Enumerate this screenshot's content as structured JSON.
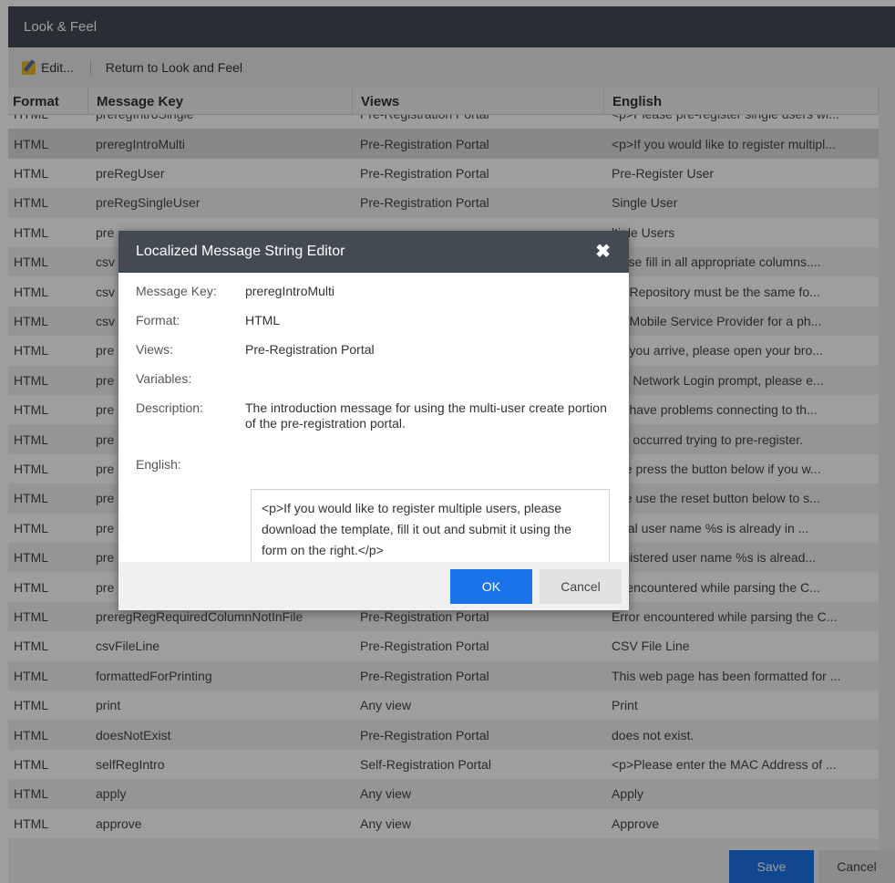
{
  "window": {
    "title": "Look & Feel"
  },
  "toolbar": {
    "edit_label": "Edit...",
    "return_label": "Return to Look and Feel"
  },
  "grid": {
    "headers": [
      "Format",
      "Message Key",
      "Views",
      "English"
    ],
    "rows": [
      {
        "format": "HTML",
        "key": "preregIntroSingle",
        "views": "Pre-Registration Portal",
        "english": "<p>Please pre-register single users wi..."
      },
      {
        "format": "HTML",
        "key": "preregIntroMulti",
        "views": "Pre-Registration Portal",
        "english": "<p>If you would like to register multipl..."
      },
      {
        "format": "HTML",
        "key": "preRegUser",
        "views": "Pre-Registration Portal",
        "english": "Pre-Register User"
      },
      {
        "format": "HTML",
        "key": "preRegSingleUser",
        "views": "Pre-Registration Portal",
        "english": "Single User"
      },
      {
        "format": "HTML",
        "key": "pre",
        "views": "",
        "english": "ltiple Users"
      },
      {
        "format": "HTML",
        "key": "csv",
        "views": "",
        "english": "lease fill in all appropriate columns...."
      },
      {
        "format": "HTML",
        "key": "csv",
        "views": "",
        "english": "he Repository must be the same fo..."
      },
      {
        "format": "HTML",
        "key": "csv",
        "views": "",
        "english": "he Mobile Service Provider for a ph..."
      },
      {
        "format": "HTML",
        "key": "pre",
        "views": "",
        "english": "en you arrive, please open your bro..."
      },
      {
        "format": "HTML",
        "key": "pre",
        "views": "",
        "english": "the Network Login prompt, please e..."
      },
      {
        "format": "HTML",
        "key": "pre",
        "views": "",
        "english": "ou have problems connecting to th..."
      },
      {
        "format": "HTML",
        "key": "pre",
        "views": "",
        "english": "ors occurred trying to pre-register."
      },
      {
        "format": "HTML",
        "key": "pre",
        "views": "",
        "english": "ase press the button below if you w..."
      },
      {
        "format": "HTML",
        "key": "pre",
        "views": "",
        "english": "ase use the reset button below to s..."
      },
      {
        "format": "HTML",
        "key": "pre",
        "views": "",
        "english": "local user name %s is already in ..."
      },
      {
        "format": "HTML",
        "key": "pre",
        "views": "",
        "english": "registered user name %s is alread..."
      },
      {
        "format": "HTML",
        "key": "pre",
        "views": "",
        "english": "or encountered while parsing the C..."
      },
      {
        "format": "HTML",
        "key": "preregRegRequiredColumnNotInFile",
        "views": "Pre-Registration Portal",
        "english": "Error encountered while parsing the C..."
      },
      {
        "format": "HTML",
        "key": "csvFileLine",
        "views": "Pre-Registration Portal",
        "english": "CSV File Line"
      },
      {
        "format": "HTML",
        "key": "formattedForPrinting",
        "views": "Pre-Registration Portal",
        "english": "This web page has been formatted for ..."
      },
      {
        "format": "HTML",
        "key": "print",
        "views": "Any view",
        "english": "Print"
      },
      {
        "format": "HTML",
        "key": "doesNotExist",
        "views": "Pre-Registration Portal",
        "english": "does not exist."
      },
      {
        "format": "HTML",
        "key": "selfRegIntro",
        "views": "Self-Registration Portal",
        "english": "<p>Please enter the MAC Address of ..."
      },
      {
        "format": "HTML",
        "key": "apply",
        "views": "Any view",
        "english": "Apply"
      },
      {
        "format": "HTML",
        "key": "approve",
        "views": "Any view",
        "english": "Approve"
      }
    ]
  },
  "footer": {
    "save_label": "Save",
    "cancel_label": "Cancel"
  },
  "dialog": {
    "title": "Localized Message String Editor",
    "close_glyph": "✖",
    "labels": {
      "message_key": "Message Key:",
      "format": "Format:",
      "views": "Views:",
      "variables": "Variables:",
      "description": "Description:",
      "english": "English:"
    },
    "values": {
      "message_key": "preregIntroMulti",
      "format": "HTML",
      "views": "Pre-Registration Portal",
      "variables": "",
      "description": "The introduction message for using the multi-user create portion of the pre-registration portal.",
      "english": "<p>If you would like to register multiple users, please download the template, fill it out and submit it using the form on the right.</p>"
    },
    "ok_label": "OK",
    "cancel_label": "Cancel"
  },
  "icons": {
    "edit": "edit-icon",
    "close": "close-icon"
  },
  "colors": {
    "titlebar": "#434a54",
    "primary_button": "#1a73e8"
  }
}
